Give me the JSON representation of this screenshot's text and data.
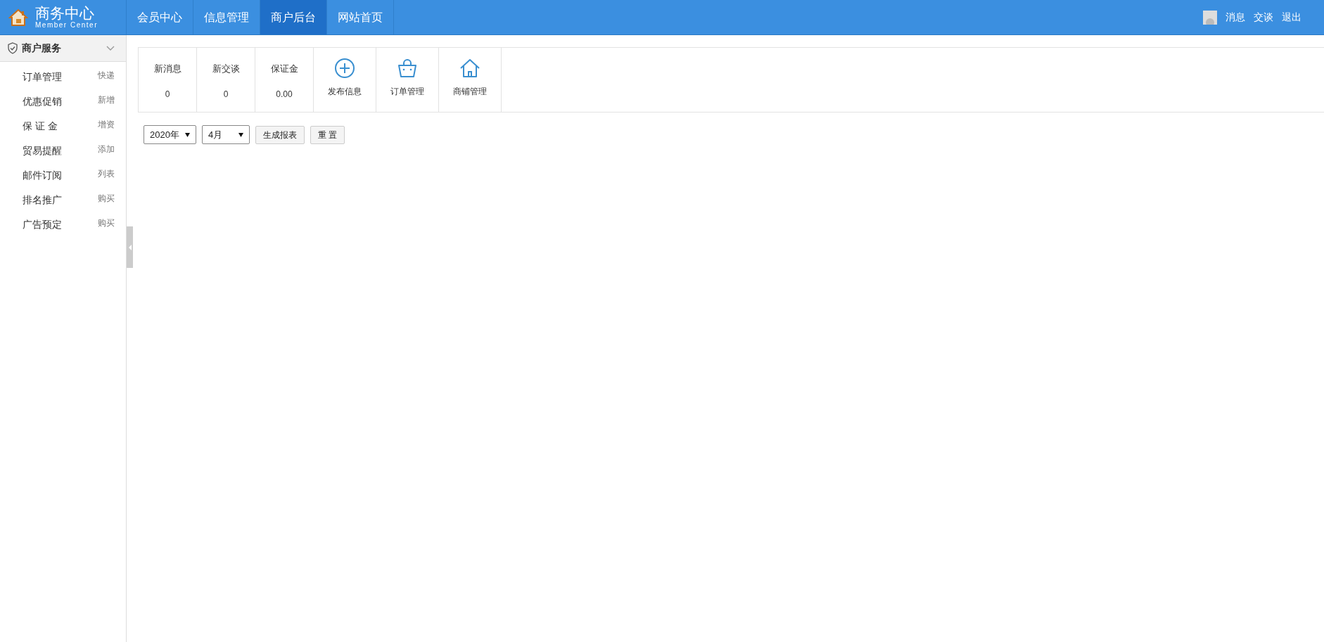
{
  "header": {
    "logo": {
      "title": "商务中心",
      "subtitle": "Member Center"
    },
    "nav": [
      {
        "label": "会员中心",
        "selected": false
      },
      {
        "label": "信息管理",
        "selected": false
      },
      {
        "label": "商户后台",
        "selected": true
      },
      {
        "label": "网站首页",
        "selected": false
      }
    ],
    "user_links": [
      "消息",
      "交谈",
      "退出"
    ]
  },
  "sidebar": {
    "section": {
      "title": "商户服务",
      "expanded": true
    },
    "items": [
      {
        "label": "订单管理",
        "action": "快递"
      },
      {
        "label": "优惠促销",
        "action": "新增"
      },
      {
        "label": "保 证 金",
        "action": "增资"
      },
      {
        "label": "贸易提醒",
        "action": "添加"
      },
      {
        "label": "邮件订阅",
        "action": "列表"
      },
      {
        "label": "排名推广",
        "action": "购买"
      },
      {
        "label": "广告预定",
        "action": "购买"
      }
    ]
  },
  "stats": [
    {
      "kind": "stat",
      "label": "新消息",
      "value": "0"
    },
    {
      "kind": "stat",
      "label": "新交谈",
      "value": "0"
    },
    {
      "kind": "stat",
      "label": "保证金",
      "value": "0.00"
    },
    {
      "kind": "shortcut",
      "label": "发布信息"
    },
    {
      "kind": "shortcut",
      "label": "订单管理"
    },
    {
      "kind": "shortcut",
      "label": "商铺管理"
    }
  ],
  "filters": {
    "year": {
      "value": "2020年"
    },
    "month": {
      "value": "4月"
    },
    "buttons": [
      "生成报表",
      "重 置"
    ]
  }
}
